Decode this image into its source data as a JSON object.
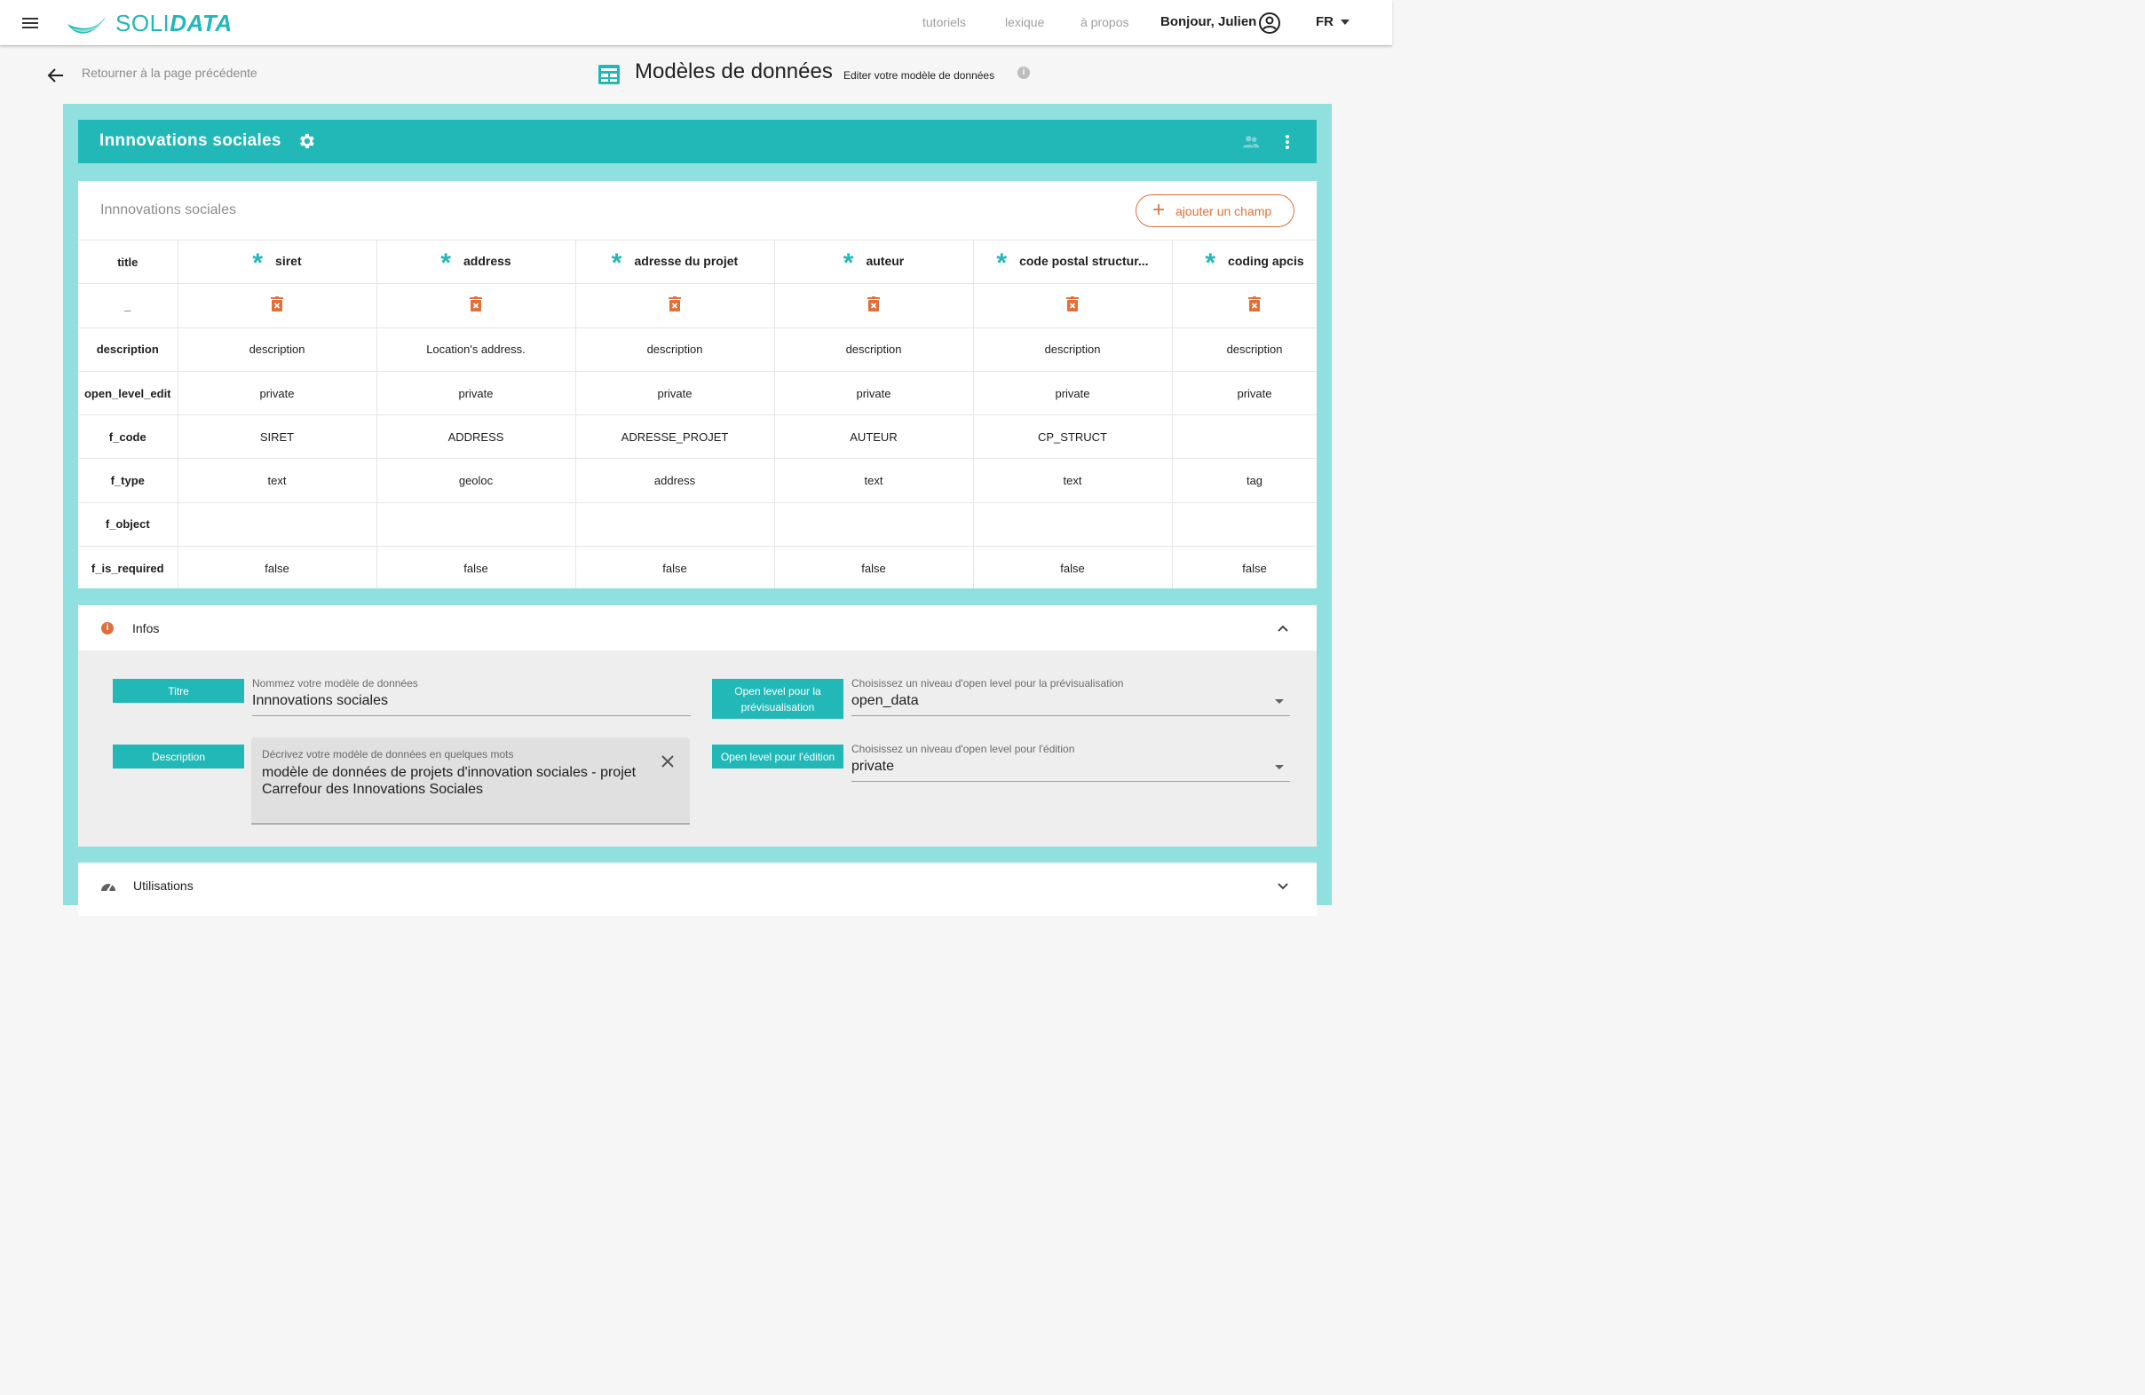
{
  "nav": {
    "brand_prefix": "SOLI",
    "brand_suffix": "DATA",
    "links": [
      "tutoriels",
      "lexique",
      "à propos"
    ],
    "greeting": "Bonjour, Julien",
    "language": "FR"
  },
  "subheader": {
    "back_label": "Retourner à la page précédente",
    "title": "Modèles de données",
    "subtitle": "Editer votre modèle de données"
  },
  "model": {
    "name": "Innnovations sociales",
    "card_title": "Innnovations sociales",
    "add_field_label": "ajouter un champ"
  },
  "fields_table": {
    "row_headers": [
      "title",
      "_",
      "description",
      "open_level_edit",
      "f_code",
      "f_type",
      "f_object",
      "f_is_required"
    ],
    "columns": [
      {
        "title": "siret",
        "description": "description",
        "open_level_edit": "private",
        "f_code": "SIRET",
        "f_type": "text",
        "f_object": "",
        "f_is_required": "false"
      },
      {
        "title": "address",
        "description": "Location's address.",
        "open_level_edit": "private",
        "f_code": "ADDRESS",
        "f_type": "geoloc",
        "f_object": "",
        "f_is_required": "false"
      },
      {
        "title": "adresse du projet",
        "description": "description",
        "open_level_edit": "private",
        "f_code": "ADRESSE_PROJET",
        "f_type": "address",
        "f_object": "",
        "f_is_required": "false"
      },
      {
        "title": "auteur",
        "description": "description",
        "open_level_edit": "private",
        "f_code": "AUTEUR",
        "f_type": "text",
        "f_object": "",
        "f_is_required": "false"
      },
      {
        "title": "code postal structur...",
        "description": "description",
        "open_level_edit": "private",
        "f_code": "CP_STRUCT",
        "f_type": "text",
        "f_object": "",
        "f_is_required": "false"
      },
      {
        "title": "coding apcis",
        "description": "description",
        "open_level_edit": "private",
        "f_code": "",
        "f_type": "tag",
        "f_object": "",
        "f_is_required": "false"
      }
    ]
  },
  "infos": {
    "section_label": "Infos",
    "titre_chip": "Titre",
    "titre_label": "Nommez votre modèle de données",
    "titre_value": "Innnovations sociales",
    "description_chip": "Description",
    "description_label": "Décrivez votre modèle de données en quelques mots",
    "description_value": "modèle de données de projets d'innovation sociales - projet Carrefour des Innovations Sociales",
    "preview_chip": "Open level pour la prévisualisation",
    "preview_label": "Choisissez un niveau d'open level pour la prévisualisation",
    "preview_value": "open_data",
    "edit_chip": "Open level pour l'édition",
    "edit_label": "Choisissez un niveau d'open level pour l'édition",
    "edit_value": "private"
  },
  "utilisations": {
    "section_label": "Utilisations"
  },
  "colors": {
    "teal": "#22b8b8",
    "teal_light": "#90e0e0",
    "orange": "#e0703a"
  }
}
